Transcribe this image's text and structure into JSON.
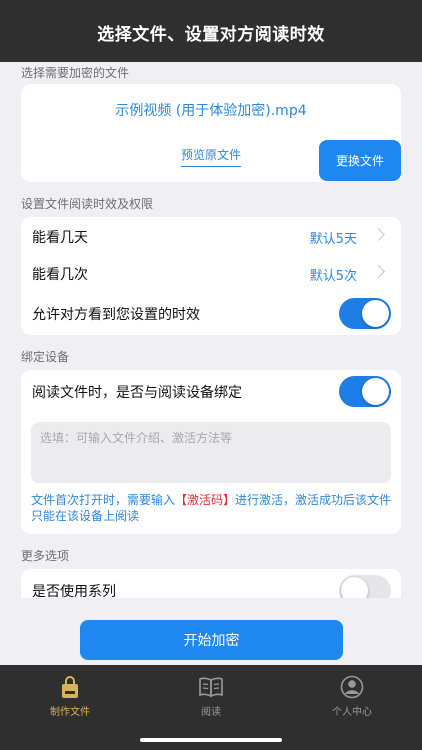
{
  "header": {
    "title": "选择文件、设置对方阅读时效"
  },
  "file_section": {
    "label": "选择需要加密的文件",
    "file_name": "示例视频 (用于体验加密).mp4",
    "preview_label": "预览原文件",
    "change_label": "更换文件"
  },
  "timing_section": {
    "label": "设置文件阅读时效及权限",
    "days": {
      "label": "能看几天",
      "value": "默认5天"
    },
    "times": {
      "label": "能看几次",
      "value": "默认5次"
    },
    "show_limits": {
      "label": "允许对方看到您设置的时效",
      "enabled": true
    }
  },
  "device_section": {
    "label": "绑定设备",
    "bind": {
      "label": "阅读文件时，是否与阅读设备绑定",
      "enabled": true
    },
    "placeholder": "选填：可输入文件介绍、激活方法等",
    "note_before": "文件首次打开时，需要输入",
    "note_highlight": "【激活码】",
    "note_after": "进行激活，激活成功后该文件只能在该设备上阅读"
  },
  "more_section": {
    "label": "更多选项",
    "series": {
      "label": "是否使用系列",
      "enabled": false
    }
  },
  "start_button": "开始加密",
  "tabbar": {
    "tabs": [
      {
        "label": "制作文件",
        "icon": "lock-file-icon",
        "active": true
      },
      {
        "label": "阅读",
        "icon": "book-icon",
        "active": false
      },
      {
        "label": "个人中心",
        "icon": "profile-icon",
        "active": false
      }
    ]
  },
  "colors": {
    "accent": "#1e88f0",
    "link": "#2f86dd",
    "dark_bar": "#2f2f2f",
    "active_tab": "#d9b25a",
    "inactive_tab": "#9a9a9a",
    "alert": "#e03030"
  }
}
